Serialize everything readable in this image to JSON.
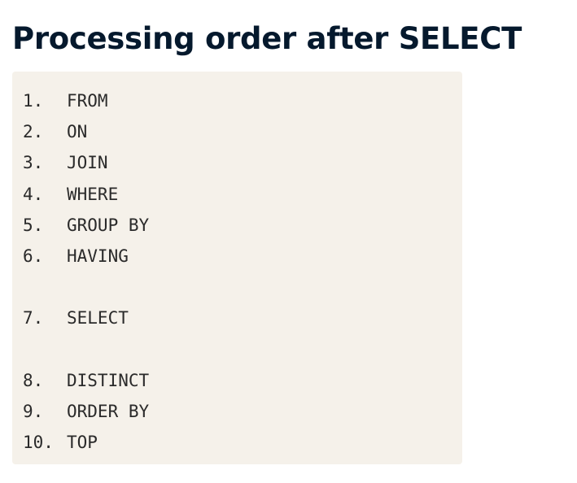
{
  "title": "Processing order after SELECT",
  "steps": [
    {
      "num": "1.",
      "text": "FROM"
    },
    {
      "num": "2.",
      "text": "ON"
    },
    {
      "num": "3.",
      "text": "JOIN"
    },
    {
      "num": "4.",
      "text": "WHERE"
    },
    {
      "num": "5.",
      "text": "GROUP BY"
    },
    {
      "num": "6.",
      "text": "HAVING"
    },
    {
      "num": "7.",
      "text": "SELECT"
    },
    {
      "num": "8.",
      "text": "DISTINCT"
    },
    {
      "num": "9.",
      "text": "ORDER BY"
    },
    {
      "num": "10.",
      "text": "TOP"
    }
  ],
  "colors": {
    "title": "#05192d",
    "code_background": "#f5f1ea",
    "code_text": "#2a2a2a"
  }
}
